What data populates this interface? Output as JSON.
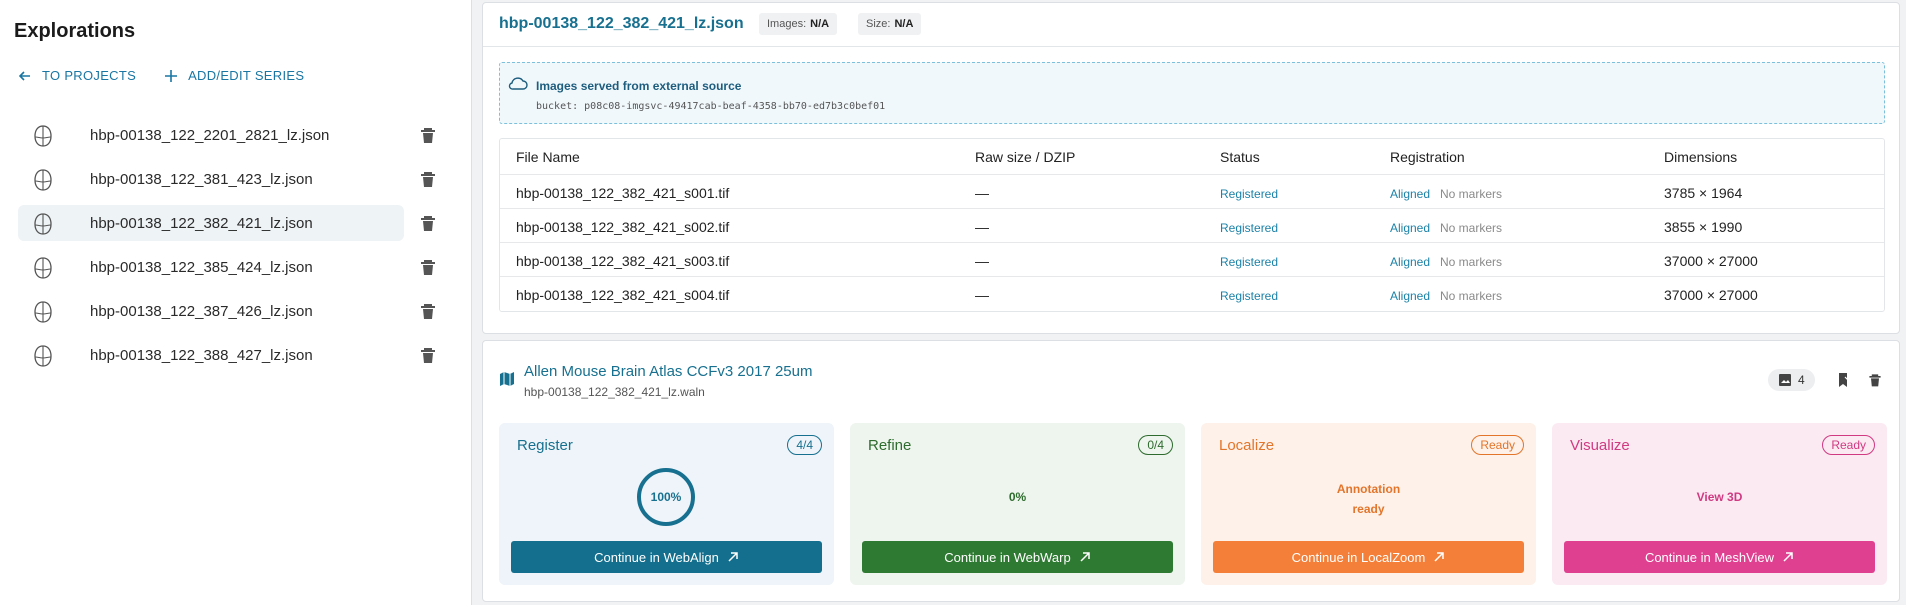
{
  "sidebar": {
    "title": "Explorations",
    "to_projects": "TO PROJECTS",
    "add_edit_series": "ADD/EDIT SERIES",
    "items": [
      {
        "label": "hbp-00138_122_2201_2821_lz.json"
      },
      {
        "label": "hbp-00138_122_381_423_lz.json"
      },
      {
        "label": "hbp-00138_122_382_421_lz.json",
        "active": true
      },
      {
        "label": "hbp-00138_122_385_424_lz.json"
      },
      {
        "label": "hbp-00138_122_387_426_lz.json"
      },
      {
        "label": "hbp-00138_122_388_427_lz.json"
      }
    ]
  },
  "header": {
    "title": "hbp-00138_122_382_421_lz.json",
    "images_label": "Images:",
    "images_value": "N/A",
    "size_label": "Size:",
    "size_value": "N/A"
  },
  "external": {
    "title": "Images served from external source",
    "bucket": "bucket: p08c08-imgsvc-49417cab-beaf-4358-bb70-ed7b3c0bef01"
  },
  "table": {
    "headers": [
      "File Name",
      "Raw size / DZIP",
      "Status",
      "Registration",
      "Dimensions"
    ],
    "rows": [
      {
        "file": "hbp-00138_122_382_421_s001.tif",
        "size": "—",
        "status": "Registered",
        "aligned": "Aligned",
        "markers": "No markers",
        "dims": "3785 × 1964"
      },
      {
        "file": "hbp-00138_122_382_421_s002.tif",
        "size": "—",
        "status": "Registered",
        "aligned": "Aligned",
        "markers": "No markers",
        "dims": "3855 × 1990"
      },
      {
        "file": "hbp-00138_122_382_421_s003.tif",
        "size": "—",
        "status": "Registered",
        "aligned": "Aligned",
        "markers": "No markers",
        "dims": "37000 × 27000"
      },
      {
        "file": "hbp-00138_122_382_421_s004.tif",
        "size": "—",
        "status": "Registered",
        "aligned": "Aligned",
        "markers": "No markers",
        "dims": "37000 × 27000"
      }
    ]
  },
  "atlas": {
    "name": "Allen Mouse Brain Atlas CCFv3 2017 25um",
    "file": "hbp-00138_122_382_421_lz.waln",
    "image_count": "4"
  },
  "steps": {
    "register": {
      "name": "Register",
      "badge": "4/4",
      "progress": "100%",
      "button": "Continue in WebAlign"
    },
    "refine": {
      "name": "Refine",
      "badge": "0/4",
      "progress": "0%",
      "button": "Continue in WebWarp"
    },
    "localize": {
      "name": "Localize",
      "badge": "Ready",
      "line1": "Annotation",
      "line2": "ready",
      "button": "Continue in LocalZoom"
    },
    "visualize": {
      "name": "Visualize",
      "badge": "Ready",
      "center": "View 3D",
      "button": "Continue in MeshView"
    }
  },
  "colors": {
    "accent": "#17708f",
    "register": "#136f8d",
    "refine": "#2e7a32",
    "localize": "#f47f38",
    "visualize": "#df4090"
  },
  "icons": [
    "arrow-left-icon",
    "plus-icon",
    "brain-icon",
    "trash-icon",
    "cloud-icon",
    "map-icon",
    "image-icon",
    "bookmark-icon",
    "external-link-icon"
  ]
}
